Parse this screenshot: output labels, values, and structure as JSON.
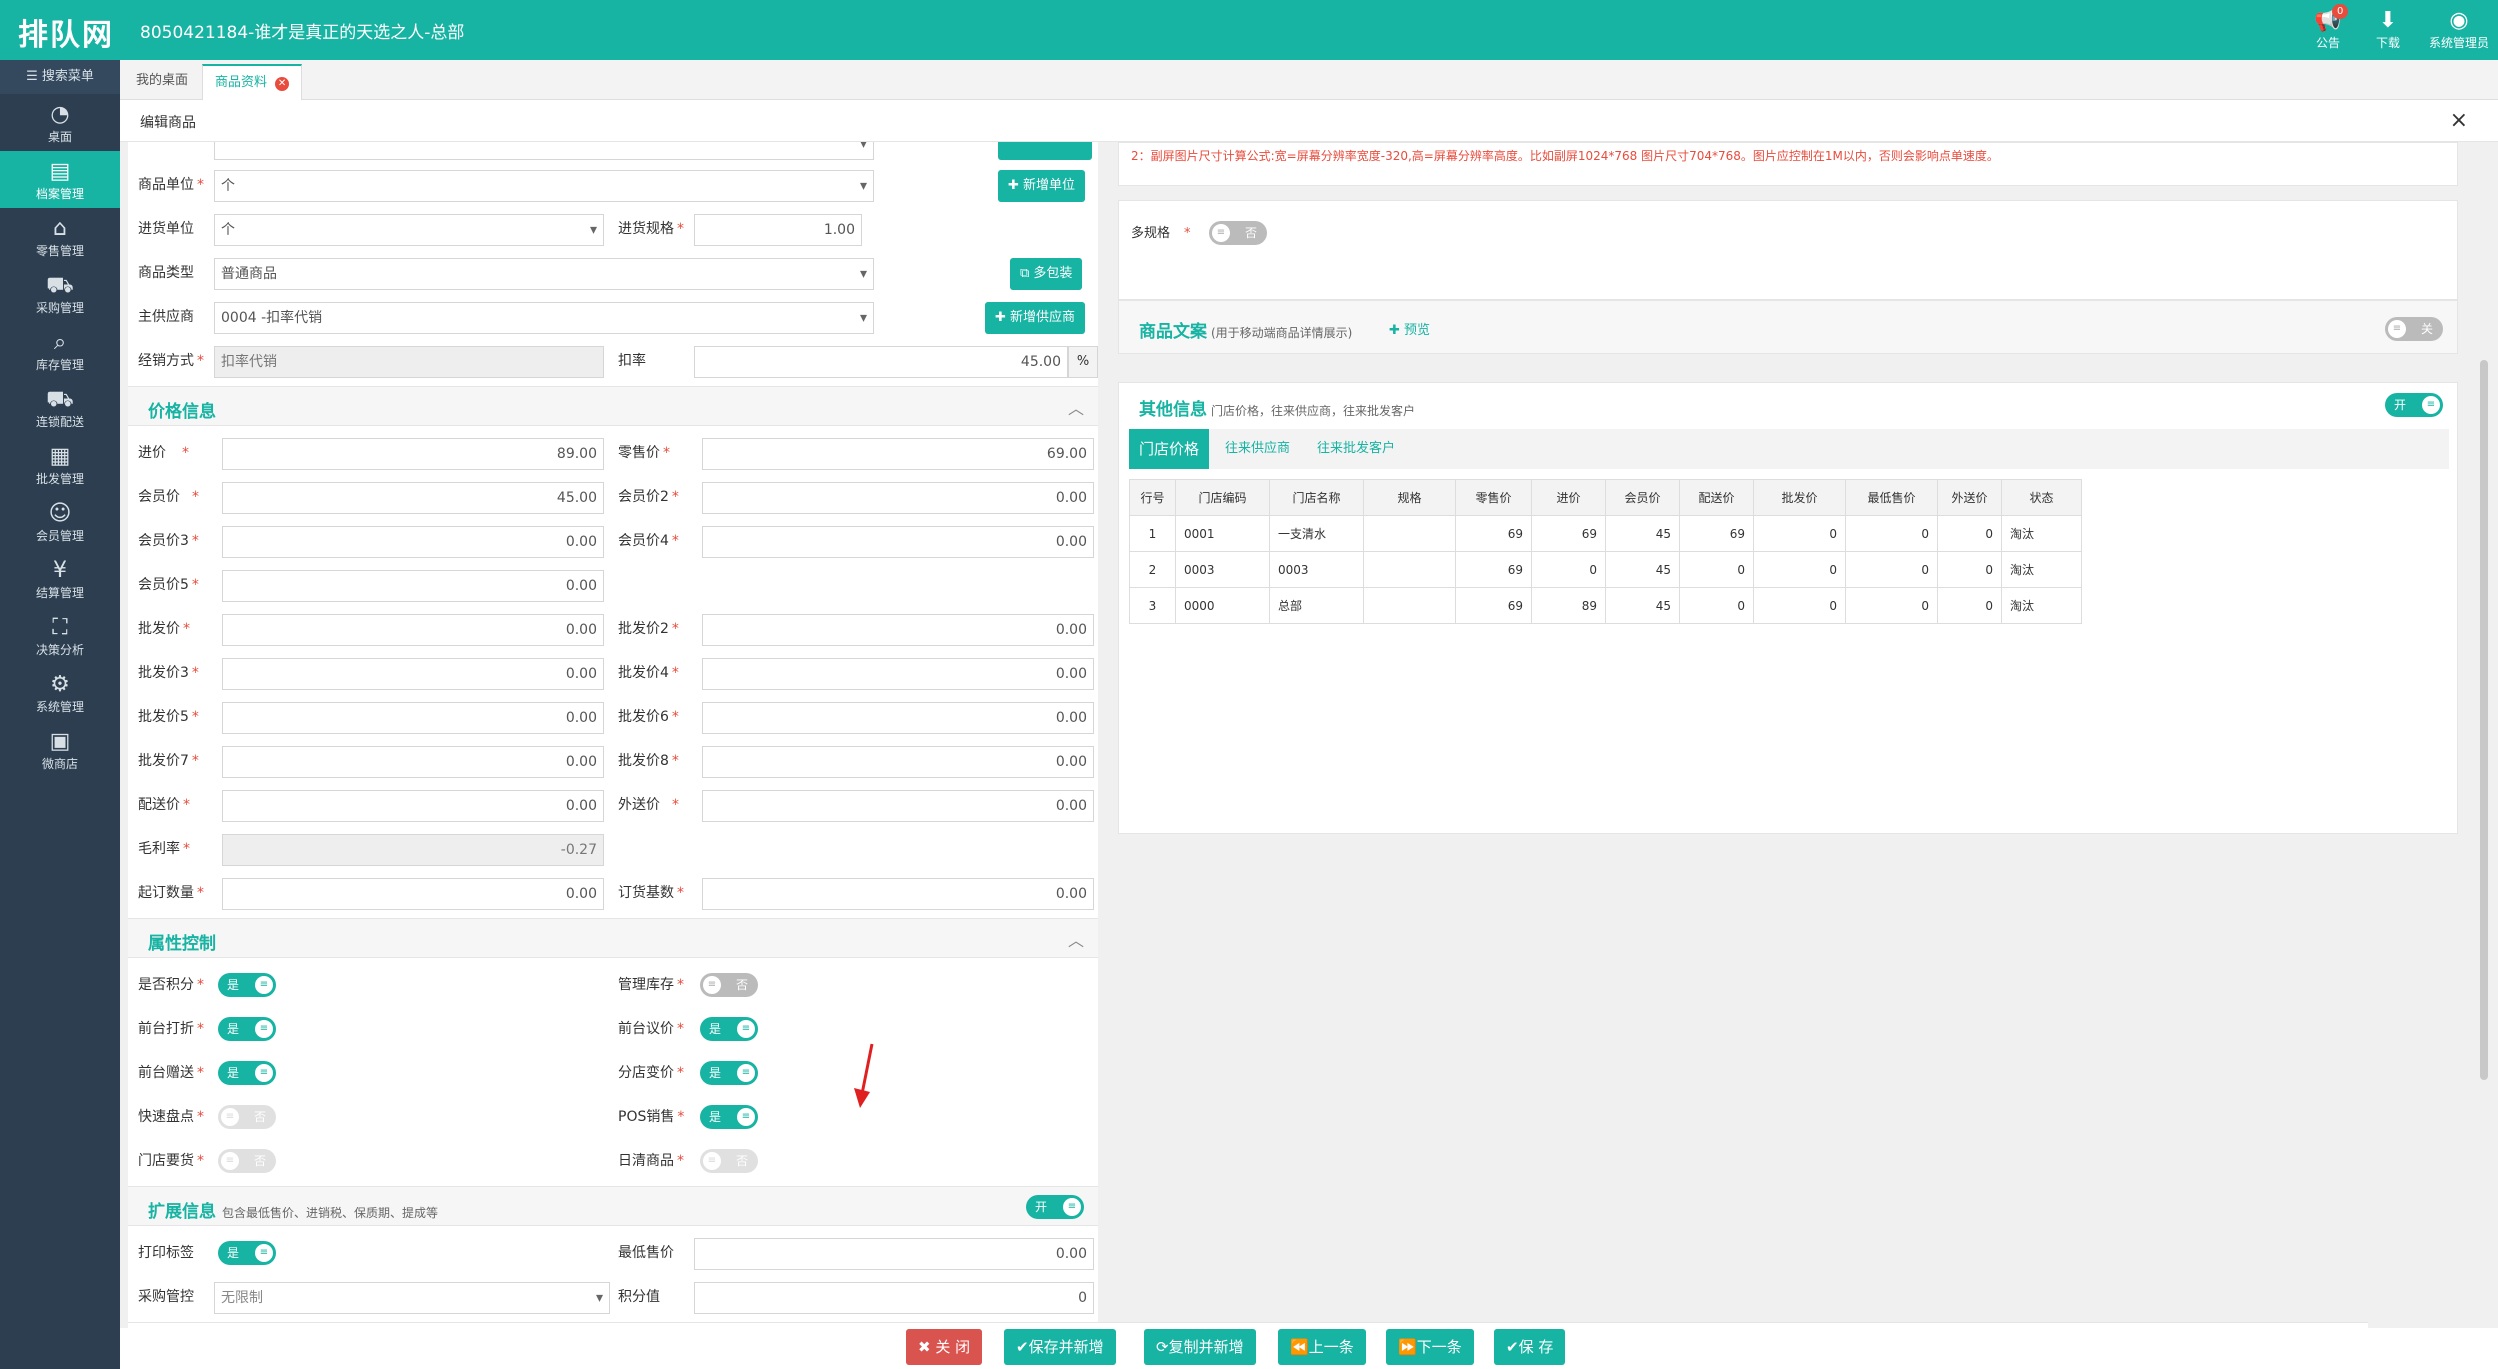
{
  "app": {
    "logo": "排队网",
    "title": "8050421184-谁才是真正的天选之人-总部"
  },
  "topbar": {
    "notice_label": "公告",
    "notice_count": "0",
    "download_label": "下载",
    "user_label": "系统管理员"
  },
  "sidebar": {
    "search_label": "搜索菜单",
    "items": [
      {
        "label": "桌面",
        "icon": "dashboard-icon"
      },
      {
        "label": "档案管理",
        "icon": "archive-icon"
      },
      {
        "label": "零售管理",
        "icon": "store-icon"
      },
      {
        "label": "采购管理",
        "icon": "cart-icon"
      },
      {
        "label": "库存管理",
        "icon": "inventory-icon"
      },
      {
        "label": "连锁配送",
        "icon": "truck-icon"
      },
      {
        "label": "批发管理",
        "icon": "wholesale-icon"
      },
      {
        "label": "会员管理",
        "icon": "member-icon"
      },
      {
        "label": "结算管理",
        "icon": "settlement-icon"
      },
      {
        "label": "决策分析",
        "icon": "chart-icon"
      },
      {
        "label": "系统管理",
        "icon": "gear-icon"
      },
      {
        "label": "微商店",
        "icon": "shop-icon"
      }
    ]
  },
  "tabs": {
    "desktop": "我的桌面",
    "product": "商品资料"
  },
  "modal": {
    "title": "编辑商品",
    "close": "×"
  },
  "basic": {
    "unit_label": "商品单位",
    "unit_value": "个",
    "add_unit": "新增单位",
    "purchase_unit_label": "进货单位",
    "purchase_unit_value": "个",
    "purchase_spec_label": "进货规格",
    "purchase_spec_value": "1.00",
    "type_label": "商品类型",
    "type_value": "普通商品",
    "multi_pack": "多包装",
    "supplier_label": "主供应商",
    "supplier_value": "0004 -扣率代销",
    "add_supplier": "新增供应商",
    "sale_mode_label": "经销方式",
    "sale_mode_value": "扣率代销",
    "discount_label": "扣率",
    "discount_value": "45.00",
    "discount_unit": "%"
  },
  "price": {
    "title": "价格信息",
    "fields": [
      {
        "label": "进价",
        "value": "89.00"
      },
      {
        "label": "零售价",
        "value": "69.00"
      },
      {
        "label": "会员价",
        "value": "45.00"
      },
      {
        "label": "会员价2",
        "value": "0.00"
      },
      {
        "label": "会员价3",
        "value": "0.00"
      },
      {
        "label": "会员价4",
        "value": "0.00"
      },
      {
        "label": "会员价5",
        "value": "0.00"
      },
      {
        "label": "批发价",
        "value": "0.00"
      },
      {
        "label": "批发价2",
        "value": "0.00"
      },
      {
        "label": "批发价3",
        "value": "0.00"
      },
      {
        "label": "批发价4",
        "value": "0.00"
      },
      {
        "label": "批发价5",
        "value": "0.00"
      },
      {
        "label": "批发价6",
        "value": "0.00"
      },
      {
        "label": "批发价7",
        "value": "0.00"
      },
      {
        "label": "批发价8",
        "value": "0.00"
      },
      {
        "label": "配送价",
        "value": "0.00"
      },
      {
        "label": "外送价",
        "value": "0.00"
      },
      {
        "label": "毛利率",
        "value": "-0.27"
      },
      {
        "label": "起订数量",
        "value": "0.00"
      },
      {
        "label": "订货基数",
        "value": "0.00"
      }
    ]
  },
  "attr": {
    "title": "属性控制",
    "on_text": "是",
    "off_text": "否",
    "items": [
      {
        "label": "是否积分",
        "state": "on"
      },
      {
        "label": "管理库存",
        "state": "off"
      },
      {
        "label": "前台打折",
        "state": "on"
      },
      {
        "label": "前台议价",
        "state": "on"
      },
      {
        "label": "前台赠送",
        "state": "on"
      },
      {
        "label": "分店变价",
        "state": "on"
      },
      {
        "label": "快速盘点",
        "state": "off-dim"
      },
      {
        "label": "POS销售",
        "state": "on"
      },
      {
        "label": "门店要货",
        "state": "off-dim"
      },
      {
        "label": "日清商品",
        "state": "off-dim"
      }
    ]
  },
  "ext": {
    "title": "扩展信息",
    "subtitle": "包含最低售价、进销税、保质期、提成等",
    "toggle": "开",
    "print_label": "打印标签",
    "print_toggle": "是",
    "min_price_label": "最低售价",
    "min_price_value": "0.00",
    "purchase_ctrl_label": "采购管控",
    "purchase_ctrl_value": "无限制",
    "points_label": "积分值",
    "points_value": "0"
  },
  "right": {
    "warn": "2：副屏图片尺寸计算公式:宽=屏幕分辨率宽度-320,高=屏幕分辨率高度。比如副屏1024*768 图片尺寸704*768。图片应控制在1M以内，否则会影响点单速度。",
    "multi_spec_label": "多规格",
    "multi_spec_toggle": "否",
    "copy_title": "商品文案",
    "copy_sub": "(用于移动端商品详情展示)",
    "preview": "预览",
    "copy_toggle": "关",
    "other_title": "其他信息",
    "other_sub": "门店价格，往来供应商，往来批发客户",
    "other_toggle": "开",
    "tabs": [
      "门店价格",
      "往来供应商",
      "往来批发客户"
    ],
    "table": {
      "headers": [
        "行号",
        "门店编码",
        "门店名称",
        "规格",
        "零售价",
        "进价",
        "会员价",
        "配送价",
        "批发价",
        "最低售价",
        "外送价",
        "状态"
      ],
      "rows": [
        [
          "1",
          "0001",
          "一支清水",
          "",
          "69",
          "69",
          "45",
          "69",
          "0",
          "0",
          "0",
          "淘汰"
        ],
        [
          "2",
          "0003",
          "0003",
          "",
          "69",
          "0",
          "45",
          "0",
          "0",
          "0",
          "0",
          "淘汰"
        ],
        [
          "3",
          "0000",
          "总部",
          "",
          "69",
          "89",
          "45",
          "0",
          "0",
          "0",
          "0",
          "淘汰"
        ]
      ]
    }
  },
  "footer": {
    "close": "关 闭",
    "save_new": "保存并新增",
    "copy_new": "复制并新增",
    "prev": "上一条",
    "next": "下一条",
    "save": "保 存"
  },
  "colors": {
    "accent": "#17b3a3",
    "sidebar": "#2c3e50",
    "danger": "#d9534f"
  }
}
